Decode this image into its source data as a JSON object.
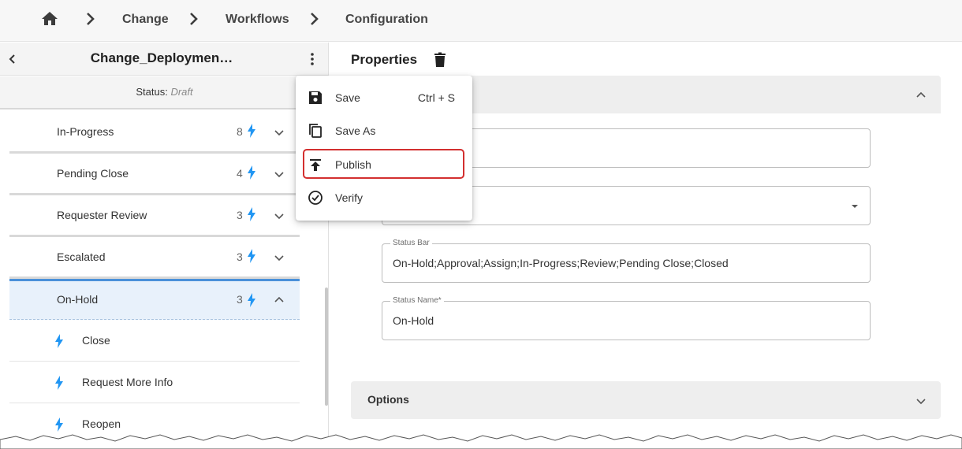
{
  "breadcrumb": {
    "items": [
      "Change",
      "Workflows",
      "Configuration"
    ]
  },
  "workflow": {
    "title": "Change_Deploymen…",
    "status_label": "Status:",
    "status_value": "Draft"
  },
  "states": [
    {
      "label": "In-Progress",
      "count": "8",
      "expanded": false
    },
    {
      "label": "Pending Close",
      "count": "4",
      "expanded": false
    },
    {
      "label": "Requester Review",
      "count": "3",
      "expanded": false
    },
    {
      "label": "Escalated",
      "count": "3",
      "expanded": false
    },
    {
      "label": "On-Hold",
      "count": "3",
      "expanded": true
    }
  ],
  "actions": [
    "Close",
    "Request More Info",
    "Reopen"
  ],
  "properties": {
    "title": "Properties",
    "fields": [
      {
        "label": "",
        "value": ""
      },
      {
        "label": "",
        "value": ""
      },
      {
        "label": "Status Bar",
        "value": "On-Hold;Approval;Assign;In-Progress;Review;Pending Close;Closed"
      },
      {
        "label": "Status Name*",
        "value": "On-Hold"
      }
    ],
    "options_label": "Options"
  },
  "menu": {
    "items": [
      {
        "label": "Save",
        "shortcut": "Ctrl + S",
        "icon": "save-icon"
      },
      {
        "label": "Save As",
        "shortcut": "",
        "icon": "copy-icon"
      },
      {
        "label": "Publish",
        "shortcut": "",
        "icon": "publish-icon"
      },
      {
        "label": "Verify",
        "shortcut": "",
        "icon": "check-circle-icon"
      }
    ],
    "highlighted": "Publish"
  },
  "colors": {
    "accent": "#4a90d9",
    "bolt": "#2196f3",
    "highlight": "#d32f2f"
  }
}
